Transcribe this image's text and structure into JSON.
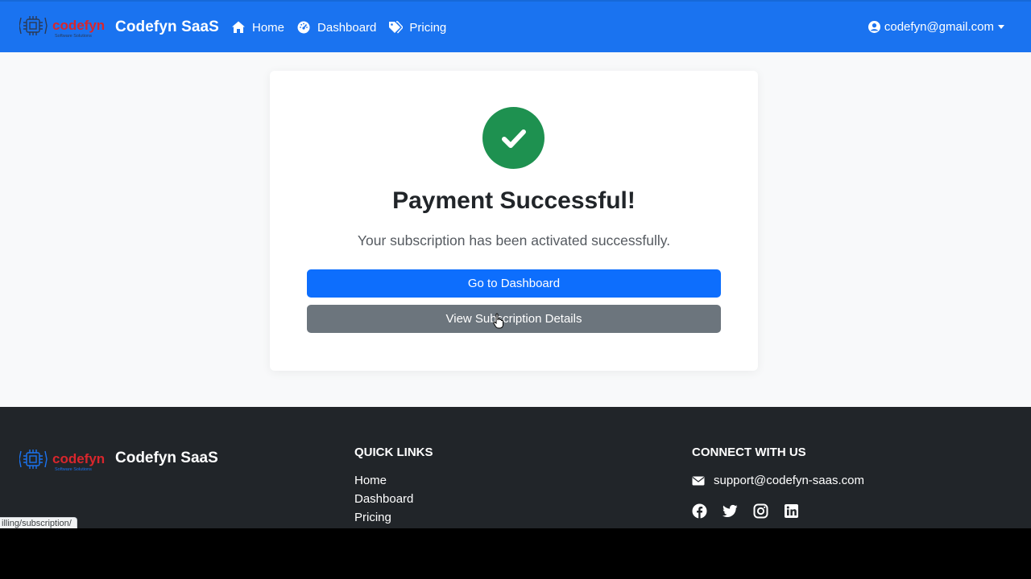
{
  "navbar": {
    "logo_text": "codefyn",
    "logo_subtext": "Software Solutions",
    "brand": "Codefyn SaaS",
    "links": [
      {
        "label": "Home",
        "icon": "home-icon"
      },
      {
        "label": "Dashboard",
        "icon": "dashboard-gauge-icon"
      },
      {
        "label": "Pricing",
        "icon": "tags-icon"
      }
    ],
    "user_email": "codefyn@gmail.com",
    "bg_color": "#1a73f0"
  },
  "card": {
    "title": "Payment Successful!",
    "message": "Your subscription has been activated successfully.",
    "primary_button": "Go to Dashboard",
    "secondary_button": "View Subscription Details",
    "success_color": "#1e9150"
  },
  "footer": {
    "brand": "Codefyn SaaS",
    "quick_links_heading": "QUICK LINKS",
    "quick_links": [
      "Home",
      "Dashboard",
      "Pricing"
    ],
    "connect_heading": "CONNECT WITH US",
    "email": "support@codefyn-saas.com",
    "socials": [
      "facebook-icon",
      "twitter-icon",
      "instagram-icon",
      "linkedin-icon"
    ]
  },
  "status_bar": {
    "url": "illing/subscription/"
  }
}
